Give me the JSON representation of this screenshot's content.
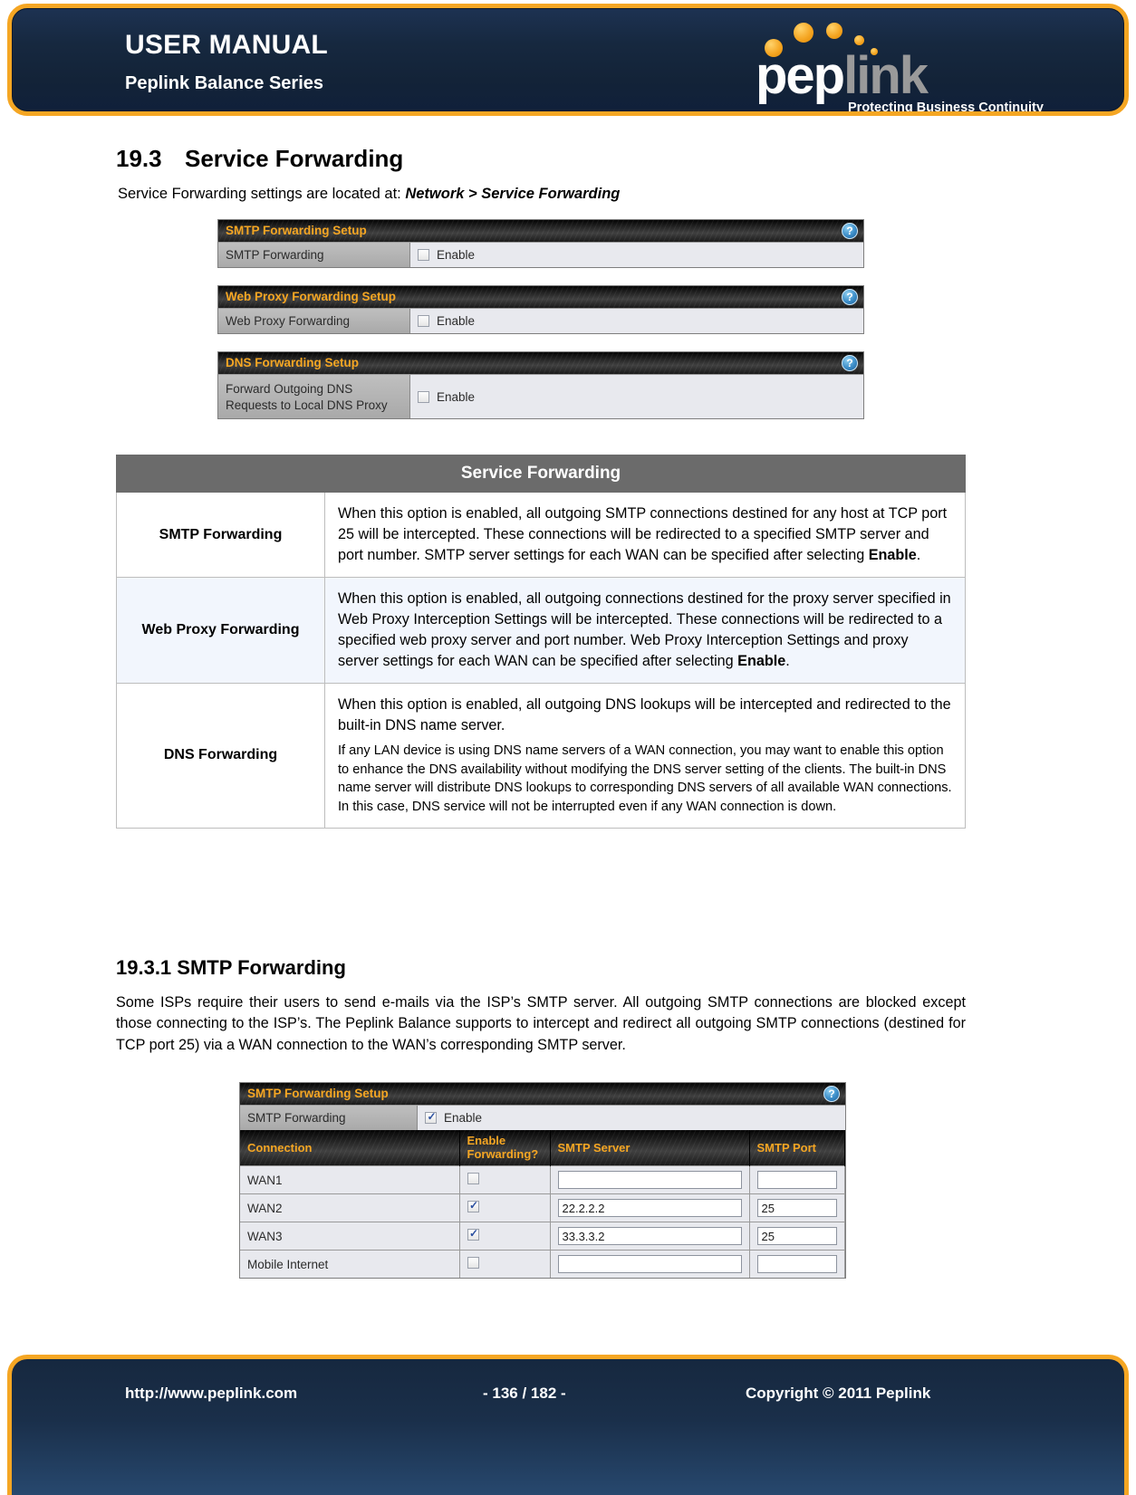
{
  "banner": {
    "title": "USER MANUAL",
    "subtitle": "Peplink Balance Series",
    "logo_pep": "pep",
    "logo_link": "link",
    "logo_tagline": "Protecting Business Continuity"
  },
  "section": {
    "number": "19.3",
    "heading": "Service Forwarding",
    "intro_prefix": "Service Forwarding settings are located at: ",
    "intro_path": "Network > Service Forwarding"
  },
  "panels": [
    {
      "title": "SMTP Forwarding Setup",
      "help": "?",
      "label": "SMTP Forwarding",
      "checkbox_label": "Enable",
      "checked": false
    },
    {
      "title": "Web Proxy Forwarding Setup",
      "help": "?",
      "label": "Web Proxy Forwarding",
      "checkbox_label": "Enable",
      "checked": false
    },
    {
      "title": "DNS Forwarding Setup",
      "help": "?",
      "label_line1": "Forward Outgoing DNS",
      "label_line2": "Requests to Local DNS Proxy",
      "checkbox_label": "Enable",
      "checked": false
    }
  ],
  "desc_table": {
    "caption": "Service Forwarding",
    "rows": [
      {
        "term": "SMTP Forwarding",
        "text": "When this option is enabled, all outgoing SMTP connections destined for any host at TCP port 25 will be intercepted. These connections will be redirected to a specified SMTP server and port number. SMTP server settings for each WAN can be specified after selecting ",
        "bold_tail": "Enable",
        "end": "."
      },
      {
        "term": "Web Proxy Forwarding",
        "text": "When this option is enabled, all outgoing connections destined for the proxy server specified in Web Proxy Interception Settings will be intercepted. These connections will be redirected to a specified web proxy server and port number. Web Proxy Interception Settings and proxy server settings for each WAN can be specified after selecting ",
        "bold_tail": "Enable",
        "end": "."
      },
      {
        "term": "DNS Forwarding",
        "text": "When this option is enabled, all outgoing DNS lookups will be intercepted and redirected to the built-in DNS name server.",
        "text2": "If any LAN device is using DNS name servers of a WAN connection, you may want to enable this option to enhance the DNS availability without modifying the DNS server setting of the clients. The built-in DNS name server will distribute DNS lookups to corresponding DNS servers of all available WAN connections. In this case, DNS service will not be interrupted even if any WAN connection is down."
      }
    ]
  },
  "subsection": {
    "heading": "19.3.1 SMTP Forwarding",
    "paragraph": "Some ISPs require their users to send e-mails via the ISP’s SMTP server.  All outgoing SMTP connections are blocked except those connecting to the ISP’s.  The Peplink Balance supports to intercept and redirect all outgoing SMTP connections (destined for TCP port 25) via a WAN connection to the WAN’s corresponding SMTP server."
  },
  "smtp_panel": {
    "title": "SMTP Forwarding Setup",
    "help": "?",
    "row_label": "SMTP Forwarding",
    "checkbox_label": "Enable",
    "checked": true,
    "columns": [
      "Connection",
      "Enable Forwarding?",
      "SMTP Server",
      "SMTP Port"
    ],
    "col_enable_line1": "Enable",
    "col_enable_line2": "Forwarding?",
    "rows": [
      {
        "connection": "WAN1",
        "enabled": false,
        "server": "",
        "port": ""
      },
      {
        "connection": "WAN2",
        "enabled": true,
        "server": "22.2.2.2",
        "port": "25"
      },
      {
        "connection": "WAN3",
        "enabled": true,
        "server": "33.3.3.2",
        "port": "25"
      },
      {
        "connection": "Mobile Internet",
        "enabled": false,
        "server": "",
        "port": ""
      }
    ]
  },
  "footer": {
    "url": "http://www.peplink.com",
    "page": "- 136 / 182 -",
    "copyright": "Copyright © 2011 Peplink"
  },
  "colors": {
    "accent_orange": "#f5a623",
    "banner_navy": "#16283f",
    "panel_title": "#f5a623",
    "table_caption_bg": "#6b6b6b",
    "alt_row": "#f2f6fd"
  }
}
